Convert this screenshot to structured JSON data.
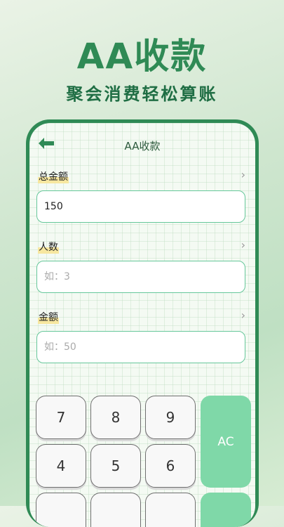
{
  "promo": {
    "title": "AA收款",
    "subtitle": "聚会消费轻松算账"
  },
  "nav": {
    "back_icon": "arrow-left-icon",
    "title": "AA收款"
  },
  "fields": [
    {
      "label": "总金额",
      "value": "150",
      "placeholder": ""
    },
    {
      "label": "人数",
      "value": "",
      "placeholder": "如：3"
    },
    {
      "label": "金额",
      "value": "",
      "placeholder": "如：50"
    }
  ],
  "keypad": {
    "row1": [
      "7",
      "8",
      "9"
    ],
    "row2": [
      "4",
      "5",
      "6"
    ],
    "clear": "AC"
  },
  "colors": {
    "accent": "#2f8a55",
    "field_border": "#66c79a",
    "clear_key": "#7fd8a8",
    "label_highlight": "#f7e7a0"
  }
}
